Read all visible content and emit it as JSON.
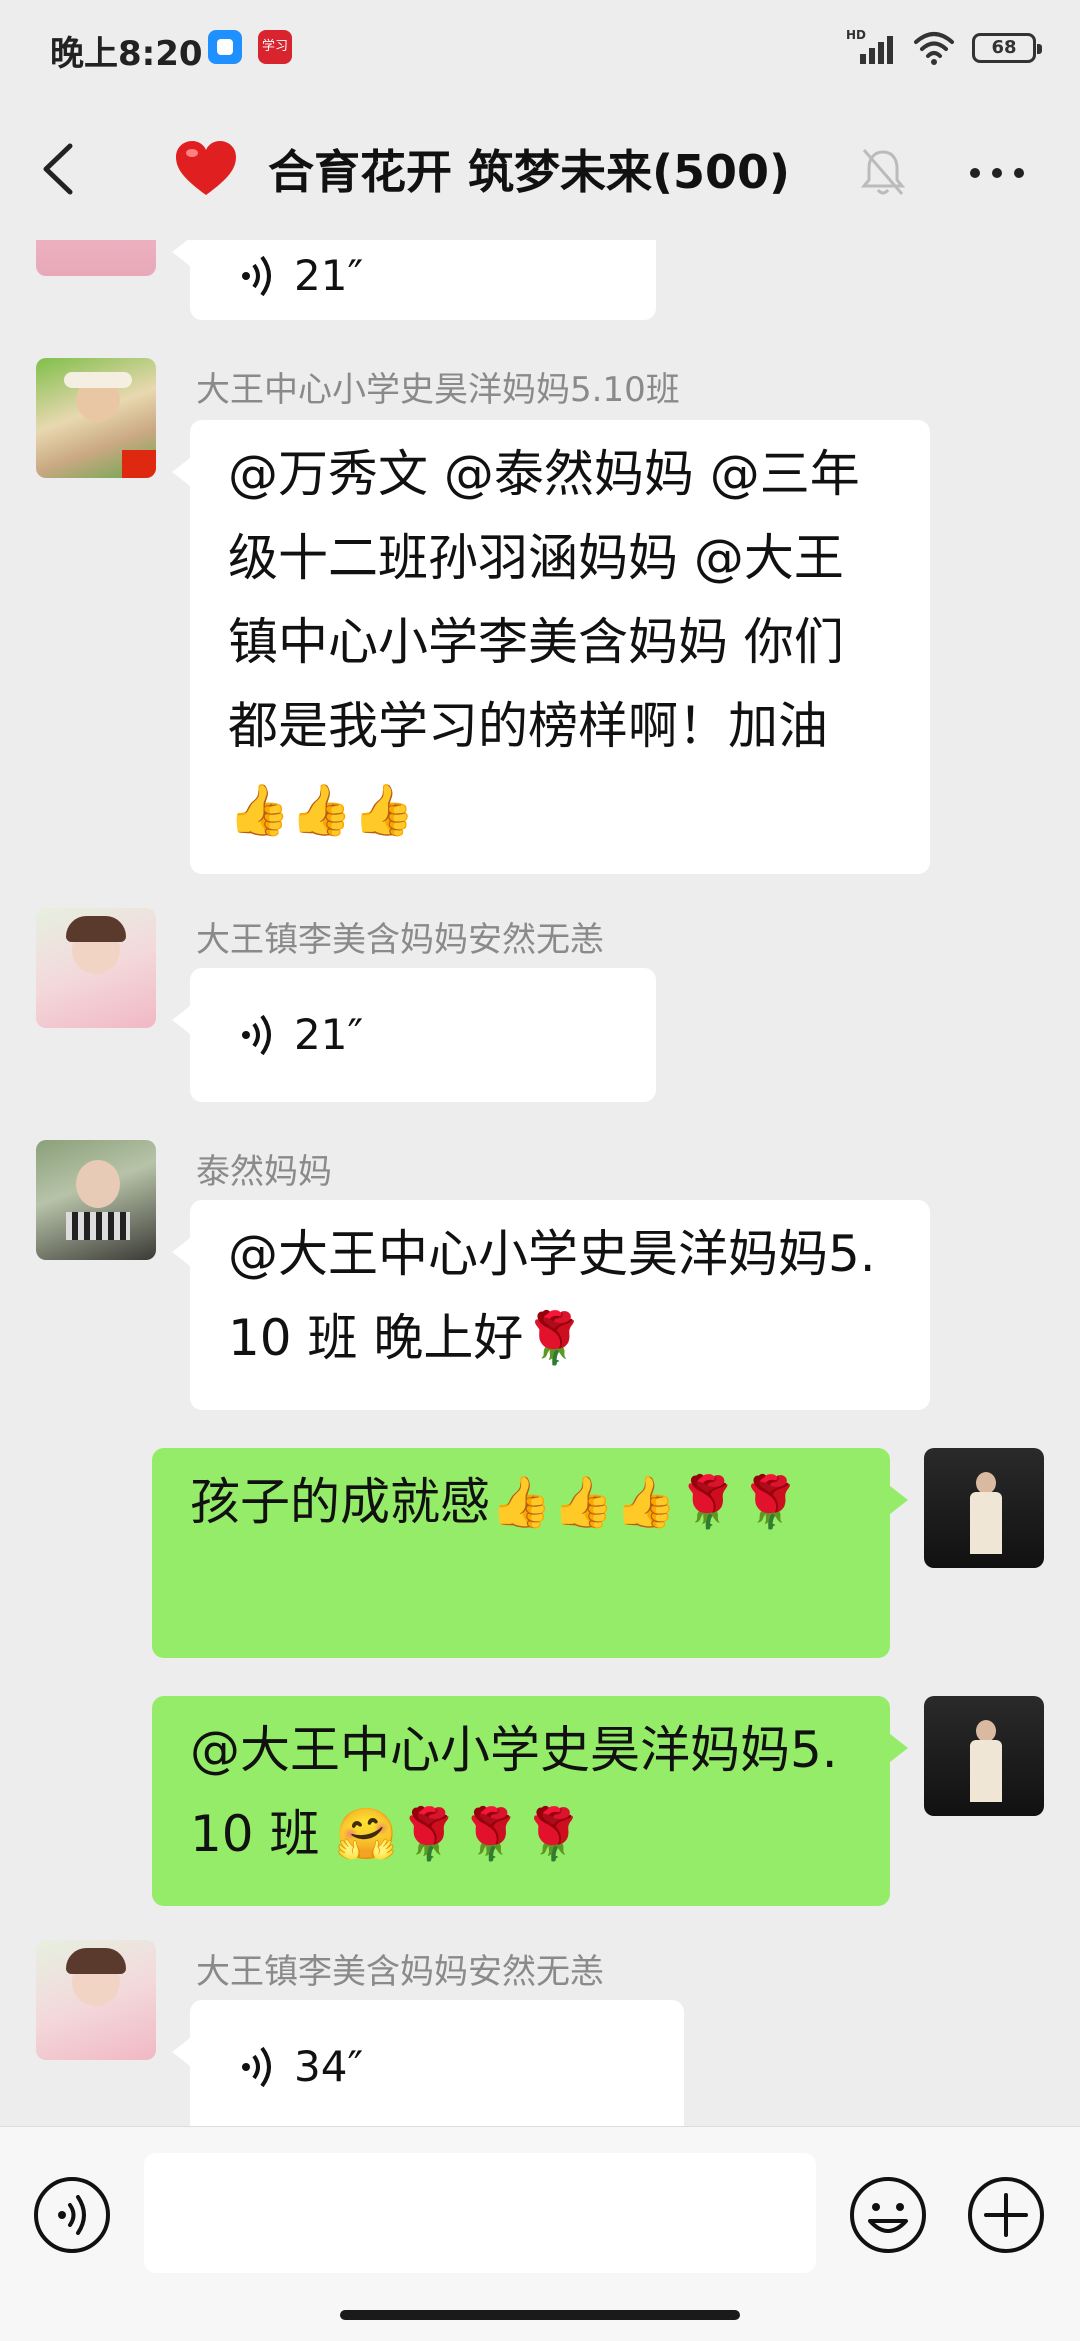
{
  "status_bar": {
    "time": "晚上8:20",
    "app2_label": "学习",
    "network": "HD",
    "battery": "68"
  },
  "header": {
    "heart_emoji": "❤️",
    "title": "合育花开 筑梦未来(500)"
  },
  "messages": [
    {
      "sender": "",
      "voice_duration": "21″"
    },
    {
      "sender": "大王中心小学史昊洋妈妈5.10班",
      "text": "@万秀文 @泰然妈妈 @三年级十二班孙羽涵妈妈 @大王镇中心小学李美含妈妈  你们都是我学习的榜样啊！加油👍👍👍"
    },
    {
      "sender": "大王镇李美含妈妈安然无恙",
      "voice_duration": "21″"
    },
    {
      "sender": "泰然妈妈",
      "text": "@大王中心小学史昊洋妈妈5.10 班  晚上好🌹"
    },
    {
      "text": "孩子的成就感👍👍👍🌹🌹"
    },
    {
      "text": "@大王中心小学史昊洋妈妈5.10 班 🤗🌹🌹🌹"
    },
    {
      "sender": "大王镇李美含妈妈安然无恙",
      "voice_duration": "34″"
    }
  ],
  "input": {
    "placeholder": ""
  },
  "colors": {
    "background": "#ededed",
    "bubble_incoming": "#ffffff",
    "bubble_outgoing": "#95ec69",
    "sender_name": "#8a8a8a"
  },
  "icons": [
    "back-icon",
    "heart-icon",
    "mute-icon",
    "more-icon",
    "voice-icon",
    "emoji-icon",
    "plus-icon"
  ]
}
